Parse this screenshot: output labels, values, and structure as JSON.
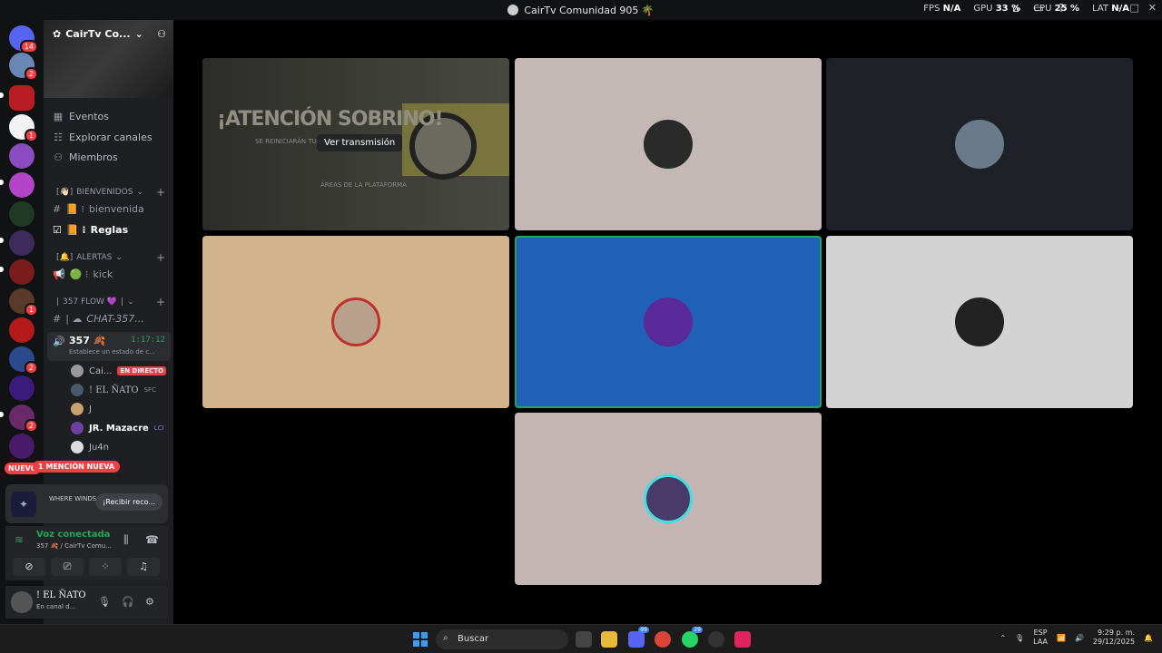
{
  "window": {
    "title": "CairTv Comunidad 905 🌴",
    "fps_label": "FPS",
    "fps": "N/A",
    "gpu_label": "GPU",
    "gpu": "33 %",
    "cpu_label": "CPU",
    "cpu": "25 %",
    "lat_label": "LAT",
    "lat": "N/A"
  },
  "rail": {
    "badges": [
      "14",
      "2",
      "1",
      "1",
      "2",
      "2"
    ],
    "nuevo": "NUEVO"
  },
  "server": {
    "name": "CairTv Co...",
    "nav": [
      "Eventos",
      "Explorar canales",
      "Miembros"
    ]
  },
  "categories": {
    "bienvenidos": "BIENVENIDOS",
    "alertas": "ALERTAS",
    "flow": "357 FLOW 💜"
  },
  "channels": {
    "bienvenida": "bienvenida",
    "reglas": "Reglas",
    "kick": "kick",
    "chat": "CHAT-357..."
  },
  "voice_channel": {
    "name": "357 🍂",
    "timer": "1:17:12",
    "status": "Establece un estado de c..."
  },
  "members": [
    {
      "name": "Cai...",
      "badge": "EN DIRECTO"
    },
    {
      "name": "! EL ÑATO",
      "badge": "SFC"
    },
    {
      "name": "J",
      "badge": ""
    },
    {
      "name": "JR. Mazacre",
      "badge": "LCI"
    },
    {
      "name": "Ju4n",
      "badge": ""
    }
  ],
  "mention": "1 MENCIÓN NUEVA",
  "promo": {
    "brand": "WHERE WINDS MEET",
    "button": "¡Recibir reco..."
  },
  "voice_connection": {
    "status": "Voz conectada",
    "location": "357 🍂 / CairTv Comu..."
  },
  "user": {
    "name": "! EL ÑATO",
    "status": "En canal d..."
  },
  "stage": {
    "stream_button": "Ver transmisión",
    "stream_headline": "¡ATENCIÓN SOBRINO!",
    "stream_sub": "SE REINICIARÁN TUS PUNTOS",
    "stream_area": "ÁREAS DE LA PLATAFORMA",
    "tile_colors": [
      "#c4b8b6",
      "#1e2128",
      "#d2b48c",
      "#2060b8",
      "#d3d3d3",
      "#c4b5b5"
    ]
  },
  "taskbar": {
    "search": "Buscar",
    "lang_1": "ESP",
    "lang_2": "LAA",
    "time": "9:29 p. m.",
    "date": "29/12/2025",
    "app_badges": [
      "99",
      "29"
    ]
  }
}
